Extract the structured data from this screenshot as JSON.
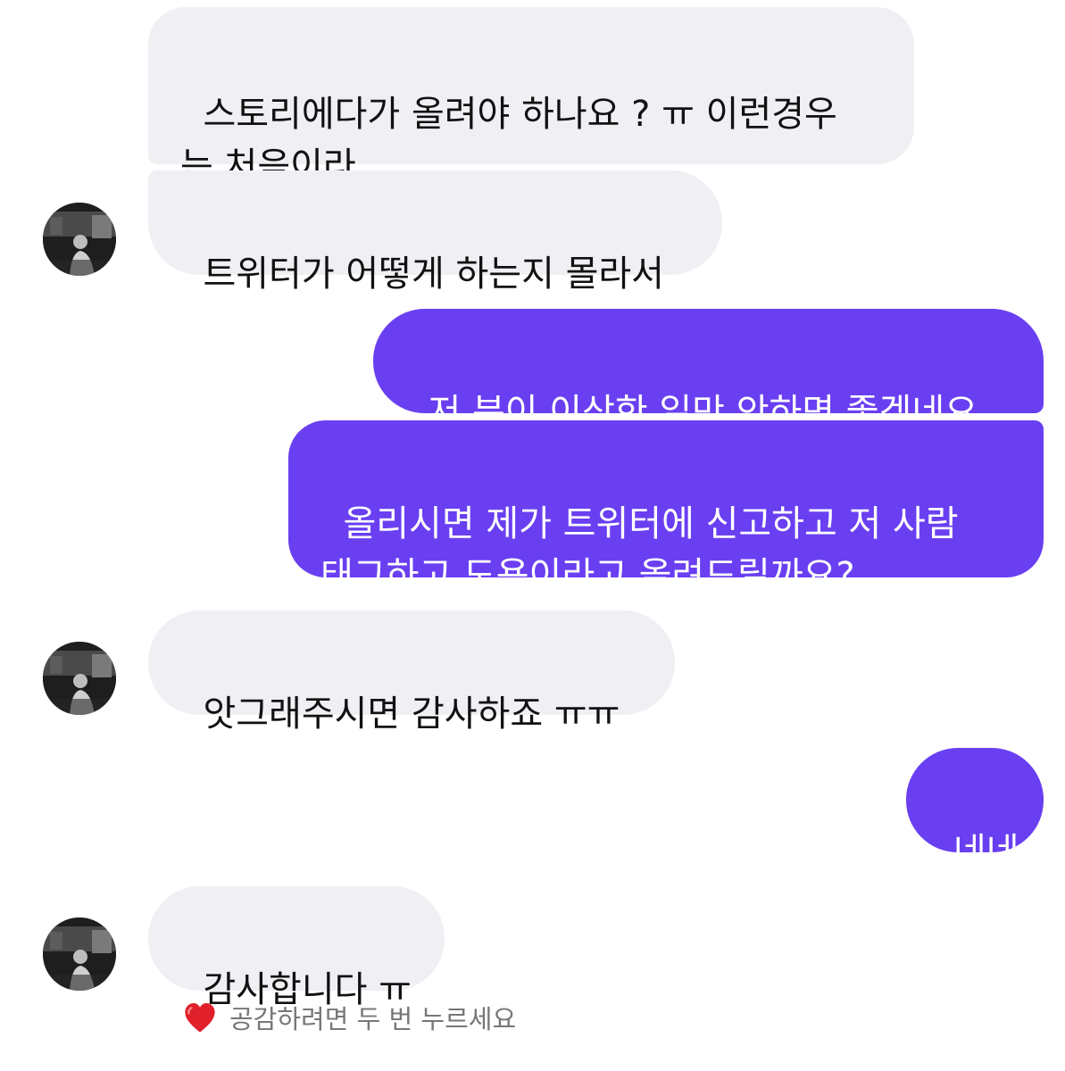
{
  "conversation": {
    "messages": [
      {
        "sender": "other",
        "text": "스토리에다가 올려야 하나요 ? ㅠ 이런경우\n는 처음이라"
      },
      {
        "sender": "other",
        "text": "트위터가 어떻게 하는지 몰라서"
      },
      {
        "sender": "me",
        "text": "저 분이 이상한 일만 안하면 좋겠네요"
      },
      {
        "sender": "me",
        "text": "올리시면 제가 트위터에 신고하고 저 사람\n태그하고 도용이라고 올려드릴까요?"
      },
      {
        "sender": "other",
        "text": "앗그래주시면 감사하죠 ㅠㅠ"
      },
      {
        "sender": "me",
        "text": "네네"
      },
      {
        "sender": "other",
        "text": "감사합니다 ㅠ"
      }
    ],
    "like_hint": "공감하려면 두 번 누르세요"
  },
  "colors": {
    "outgoing_bubble": "#6a3ff1",
    "incoming_bubble": "#efeff4",
    "hint_text": "#777777",
    "heart": "#e0202a"
  },
  "icons": {
    "like": "heart-icon",
    "avatar": "user-avatar"
  }
}
